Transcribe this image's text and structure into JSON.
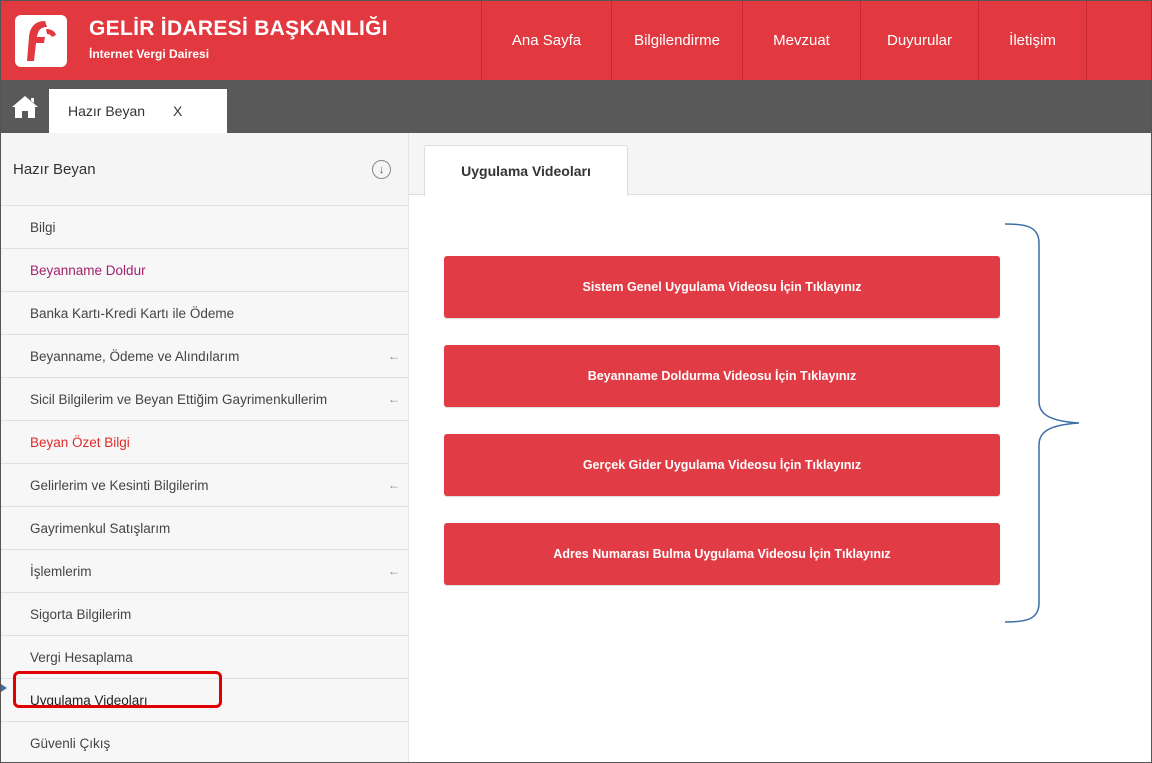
{
  "header": {
    "title": "GELİR İDARESİ BAŞKANLIĞI",
    "subtitle": "İnternet Vergi Dairesi",
    "brand_color": "#e1393f",
    "nav": [
      {
        "label": "Ana Sayfa"
      },
      {
        "label": "Bilgilendirme"
      },
      {
        "label": "Mevzuat"
      },
      {
        "label": "Duyurular"
      },
      {
        "label": "İletişim"
      }
    ]
  },
  "tabstrip": {
    "home_icon": "home-icon",
    "open_tab": {
      "label": "Hazır Beyan",
      "close": "X"
    }
  },
  "sidebar": {
    "title": "Hazır Beyan",
    "toggle_icon": "arrow-down-circle-icon",
    "toggle_glyph": "↓",
    "items": [
      {
        "label": "Bilgi"
      },
      {
        "label": "Beyanname Doldur",
        "color": "#a0226e"
      },
      {
        "label": "Banka Kartı-Kredi Kartı ile Ödeme"
      },
      {
        "label": "Beyanname, Ödeme ve Alındılarım",
        "arrow": "←"
      },
      {
        "label": "Sicil Bilgilerim ve Beyan Ettiğim Gayrimenkullerim",
        "arrow": "←"
      },
      {
        "label": "Beyan Özet Bilgi",
        "color": "#e12a2a"
      },
      {
        "label": "Gelirlerim ve Kesinti Bilgilerim",
        "arrow": "←"
      },
      {
        "label": "Gayrimenkul Satışlarım"
      },
      {
        "label": "İşlemlerim",
        "arrow": "←"
      },
      {
        "label": "Sigorta Bilgilerim"
      },
      {
        "label": "Vergi Hesaplama"
      },
      {
        "label": "Uygulama Videoları",
        "highlighted": true
      },
      {
        "label": "Güvenli Çıkış"
      }
    ]
  },
  "main": {
    "tab": "Uygulama Videoları",
    "buttons": [
      {
        "label": "Sistem Genel Uygulama Videosu İçin Tıklayınız"
      },
      {
        "label": "Beyanname Doldurma Videosu İçin Tıklayınız"
      },
      {
        "label": "Gerçek Gider Uygulama Videosu İçin Tıklayınız"
      },
      {
        "label": "Adres Numarası Bulma Uygulama Videosu İçin Tıklayınız"
      }
    ],
    "button_color": "#e13b45",
    "annotation_color": "#3a6ea5"
  }
}
